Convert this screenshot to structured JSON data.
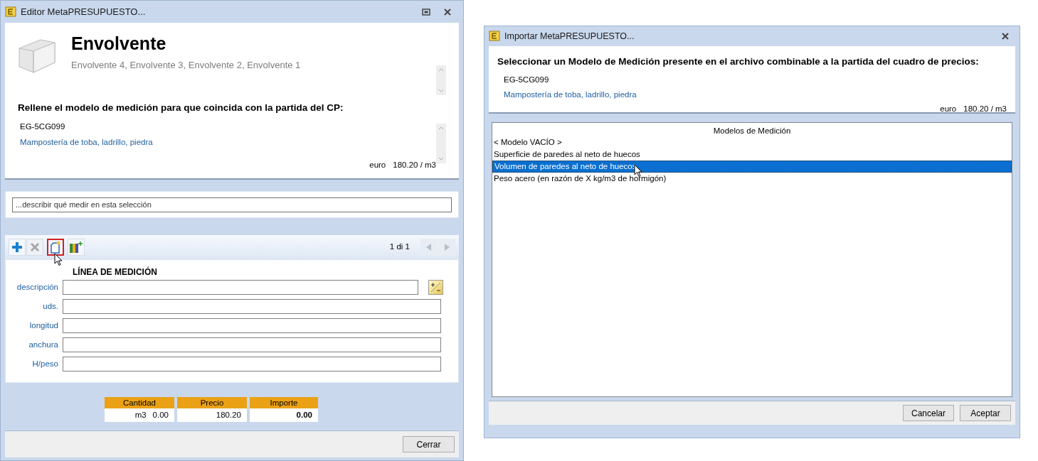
{
  "editor_window": {
    "title": "Editor MetaPRESUPUESTO...",
    "heading": "Envolvente",
    "subheading": "Envolvente 4, Envolvente 3, Envolvente 2, Envolvente 1",
    "instruction": "Rellene el modelo de medición para que coincida con la partida del CP:",
    "code": "EG-5CG099",
    "description": "Mampostería de toba, ladrillo, piedra",
    "currency": "euro",
    "price": "180.20 / m3",
    "selection_field": {
      "placeholder": "...describir qué medir en esta selección"
    },
    "tools": [
      {
        "kind": "add",
        "disabled": false,
        "highlighted": false
      },
      {
        "kind": "delete",
        "disabled": true,
        "highlighted": false
      },
      {
        "kind": "new",
        "disabled": false,
        "highlighted": true
      },
      {
        "kind": "library",
        "disabled": false,
        "highlighted": false
      }
    ],
    "pager": "1 di 1",
    "section_title": "LÍNEA DE MEDICIÓN",
    "fields": [
      {
        "label": "descripción",
        "kind": "with_button"
      },
      {
        "label": "uds.",
        "kind": "plain"
      },
      {
        "label": "longitud",
        "kind": "plain"
      },
      {
        "label": "anchura",
        "kind": "plain"
      },
      {
        "label": "H/peso",
        "kind": "plain"
      }
    ],
    "totals": [
      {
        "header": "Cantidad",
        "unit": "m3",
        "value": "0.00",
        "bold": false
      },
      {
        "header": "Precio",
        "value": "180.20",
        "bold": false
      },
      {
        "header": "Importe",
        "value": "0.00",
        "bold": true
      }
    ],
    "buttons": [
      "Cerrar"
    ]
  },
  "import_window": {
    "title": "Importar MetaPRESUPUESTO...",
    "instruction": "Seleccionar un Modelo de Medición presente en el archivo combinable a la partida del cuadro de precios:",
    "code": "EG-5CG099",
    "description": "Mampostería de toba, ladrillo, piedra",
    "currency": "euro",
    "price": "180.20 / m3",
    "list_header": "Modelos de Medición",
    "models": [
      {
        "label": "< Modelo VACÍO >",
        "selected": false
      },
      {
        "label": "Superficie de paredes al neto de huecos",
        "selected": false
      },
      {
        "label": "Volumen de paredes al neto de huecos",
        "selected": true
      },
      {
        "label": "Peso acero (en razón de X kg/m3 de hormigón)",
        "selected": false
      }
    ],
    "buttons": [
      "Cancelar",
      "Aceptar"
    ]
  }
}
